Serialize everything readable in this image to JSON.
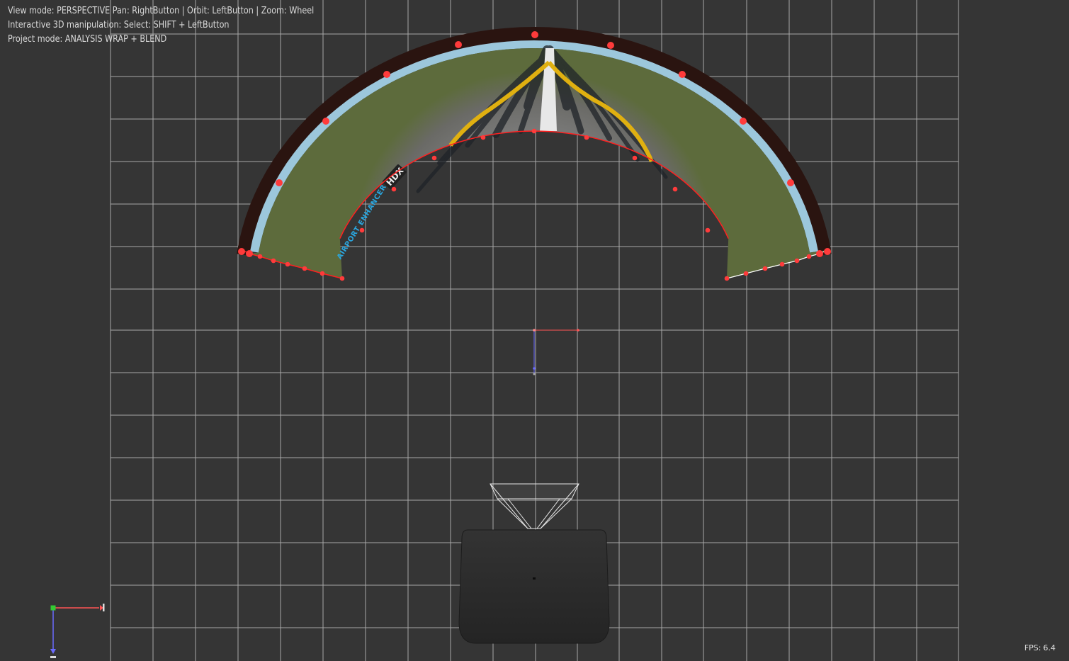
{
  "hud": {
    "view_mode": "View mode: PERSPECTIVE Pan: RightButton | Orbit: LeftButton | Zoom: Wheel",
    "manipulation": "Interactive 3D manipulation: Select: SHIFT + LeftButton",
    "project_mode": "Project mode: ANALYSIS WRAP + BLEND"
  },
  "stats": {
    "fps_label": "FPS:",
    "fps_value": "6.4"
  },
  "screen_content": {
    "brand": "AIRPORT ENHANCER",
    "badge": "HDX"
  },
  "colors": {
    "background": "#353535",
    "grid": "#bdbdbd",
    "control_point": "#ff3b3b",
    "edge": "#ff2020",
    "screen_frame": "#2a1410",
    "taxi_line": "#e0b010",
    "axis_x": "#ff5555",
    "axis_y": "#6b6bff",
    "axis_origin": "#33cc33",
    "projector_body": "#2c2c2c"
  },
  "icons": {
    "origin_gizmo": "axis-gizmo-icon",
    "projector": "projector-icon",
    "frustum": "frustum-icon"
  }
}
